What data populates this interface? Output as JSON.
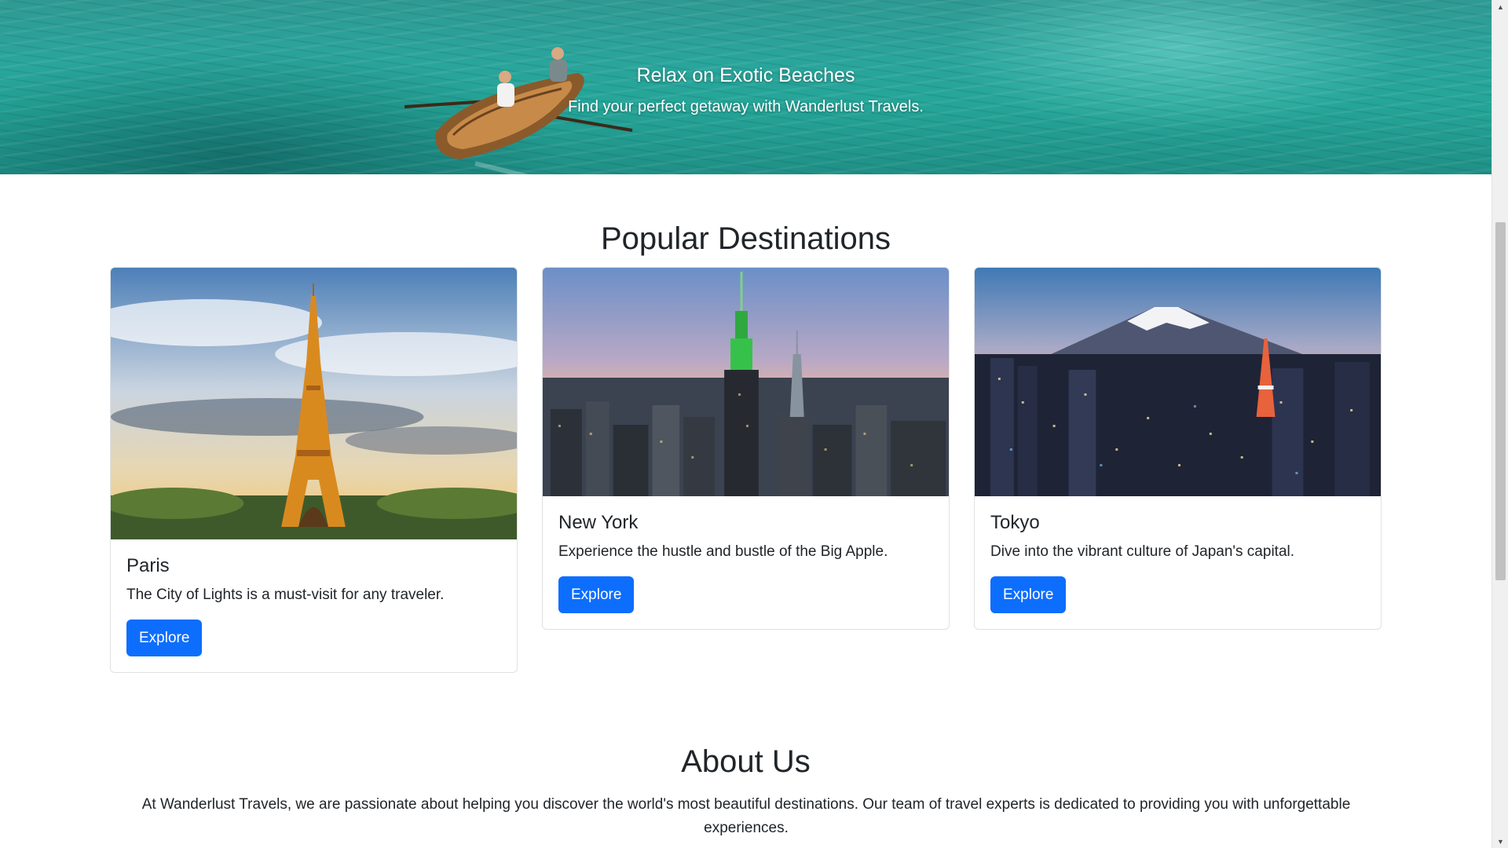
{
  "hero": {
    "title": "Relax on Exotic Beaches",
    "subtitle": "Find your perfect getaway with Wanderlust Travels."
  },
  "destinations": {
    "heading": "Popular Destinations",
    "cards": [
      {
        "title": "Paris",
        "text": "The City of Lights is a must-visit for any traveler.",
        "button": "Explore"
      },
      {
        "title": "New York",
        "text": "Experience the hustle and bustle of the Big Apple.",
        "button": "Explore"
      },
      {
        "title": "Tokyo",
        "text": "Dive into the vibrant culture of Japan's capital.",
        "button": "Explore"
      }
    ]
  },
  "about": {
    "heading": "About Us",
    "text": "At Wanderlust Travels, we are passionate about helping you discover the world's most beautiful destinations. Our team of travel experts is dedicated to providing you with unforgettable experiences."
  },
  "colors": {
    "primary_button": "#0d6efd",
    "text": "#212529",
    "card_border": "#dee2e6"
  },
  "icons": {
    "scroll_up": "scroll-up-arrow-icon",
    "scroll_down": "scroll-down-arrow-icon"
  }
}
